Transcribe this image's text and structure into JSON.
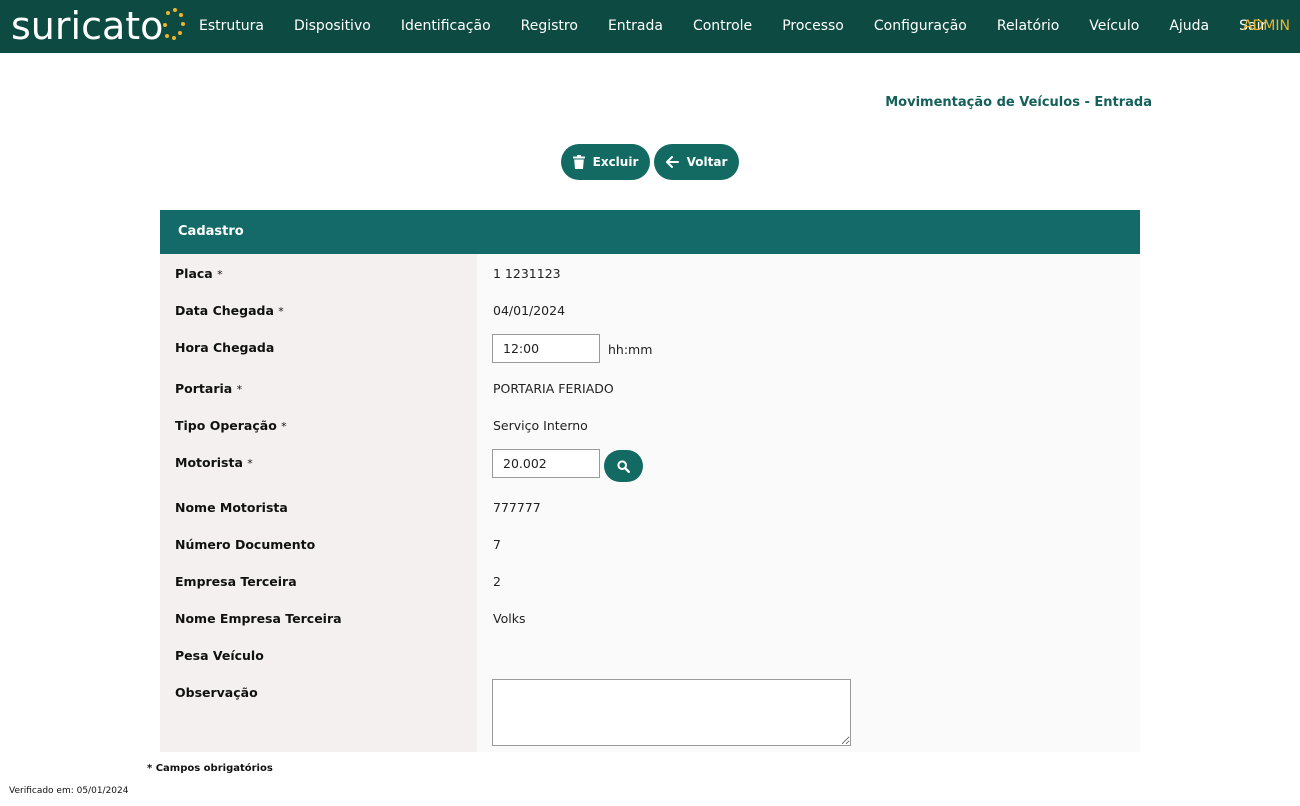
{
  "app": {
    "logo_text": "suricato",
    "brand_accent": "#f0b429",
    "header_bg": "#0d4a42",
    "primary": "#136a63"
  },
  "nav": {
    "items": [
      "Estrutura",
      "Dispositivo",
      "Identificação",
      "Registro",
      "Entrada",
      "Controle",
      "Processo",
      "Configuração",
      "Relatório",
      "Veículo",
      "Ajuda",
      "Sair"
    ],
    "user": "ADMIN"
  },
  "page": {
    "title": "Movimentação de Veículos - Entrada"
  },
  "toolbar": {
    "delete_label": "Excluir",
    "delete_icon": "trash-icon",
    "back_label": "Voltar",
    "back_icon": "arrow-left-icon"
  },
  "panel": {
    "title": "Cadastro"
  },
  "form": {
    "placa": {
      "label": "Placa",
      "required_mark": "*",
      "value": "1 1231123"
    },
    "data_chegada": {
      "label": "Data Chegada",
      "required_mark": "*",
      "value": "04/01/2024"
    },
    "hora_chegada": {
      "label": "Hora Chegada",
      "value": "12:00",
      "hint": "hh:mm"
    },
    "portaria": {
      "label": "Portaria",
      "required_mark": "*",
      "value": "PORTARIA FERIADO"
    },
    "tipo_operacao": {
      "label": "Tipo Operação",
      "required_mark": "*",
      "value": "Serviço Interno"
    },
    "motorista": {
      "label": "Motorista",
      "required_mark": "*",
      "value": "20.002",
      "search_icon": "search-icon"
    },
    "nome_motorista": {
      "label": "Nome Motorista",
      "value": "777777"
    },
    "numero_documento": {
      "label": "Número Documento",
      "value": "7"
    },
    "empresa_terceira": {
      "label": "Empresa Terceira",
      "value": "2"
    },
    "nome_empresa_terceira": {
      "label": "Nome Empresa Terceira",
      "value": "Volks"
    },
    "pesa_veiculo": {
      "label": "Pesa Veículo"
    },
    "observacao": {
      "label": "Observação",
      "value": ""
    }
  },
  "footer": {
    "required_note": "* Campos obrigatórios",
    "verified": "Verificado em: 05/01/2024"
  }
}
